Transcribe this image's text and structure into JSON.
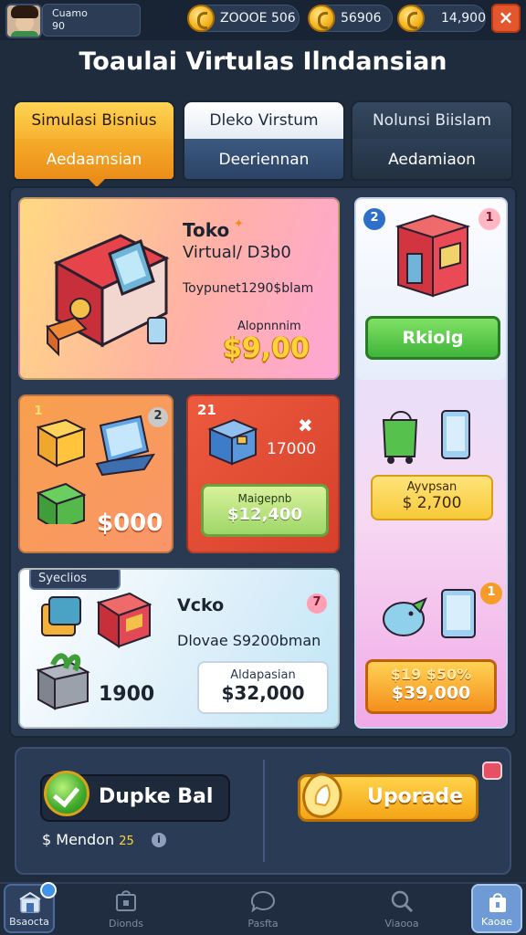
{
  "header": {
    "profile_line1": "Cuamo",
    "profile_line2": "90",
    "currency": [
      {
        "icon": "coin-icon",
        "value": "ZOOOE 506"
      },
      {
        "icon": "coin-icon",
        "value": "56906"
      },
      {
        "icon": "coin-icon",
        "value": "14,900"
      }
    ],
    "close_label": "×"
  },
  "title": "Toaulai Virtulas Ilndansian",
  "tabs": [
    {
      "top": "Simulasi Bisnius",
      "bottom": "Aedaamsian"
    },
    {
      "top": "Dleko Virstum",
      "bottom": "Deeriennan"
    },
    {
      "top": "Nolunsi Biislam",
      "bottom": "Aedamiaon"
    }
  ],
  "card_toko": {
    "title": "Toko",
    "subtitle": "Virtual/ D3b0",
    "description": "Toypunet1290$blam",
    "price_label": "Alopnnnim",
    "price": "$9,00"
  },
  "card_small_1": {
    "badge_left": "1",
    "badge_right": "2",
    "price": "$000"
  },
  "card_small_2": {
    "badge": "21",
    "corner_mark": "✖",
    "amount": "17000",
    "button_label": "Maigepnb",
    "button_price": "$12,400"
  },
  "card_vcko": {
    "tag": "Syeclios",
    "badge": "7",
    "title": "Vcko",
    "description": "Dlovae S9200bman",
    "amount": "1900",
    "price_label": "Aldapasian",
    "price": "$32,000"
  },
  "card_side": {
    "badge_left": "2",
    "badge_right": "1",
    "button_label": "Rkiolg",
    "price_label": "Ayvpsan",
    "price": "$ 2,700",
    "badge_lower": "1",
    "promo_price_top": "$19 $50%",
    "promo_price": "$39,000"
  },
  "actions": {
    "dupke_label": "Dupke Bal",
    "mendon_label": "$ Mendon",
    "mendon_value": "25",
    "info_icon": "i",
    "upgrade_label": "Uporade"
  },
  "nav": [
    {
      "label": "Bsaocta",
      "icon": "store-icon"
    },
    {
      "label": "Dionds",
      "icon": "shop-icon"
    },
    {
      "label": "Pasfta",
      "icon": "chat-icon"
    },
    {
      "label": "Viaooa",
      "icon": "search-icon"
    },
    {
      "label": "Kaoae",
      "icon": "bag-icon"
    }
  ],
  "colors": {
    "accent_orange": "#f7b331",
    "accent_green": "#3fb53a",
    "panel": "#2a3a52"
  }
}
